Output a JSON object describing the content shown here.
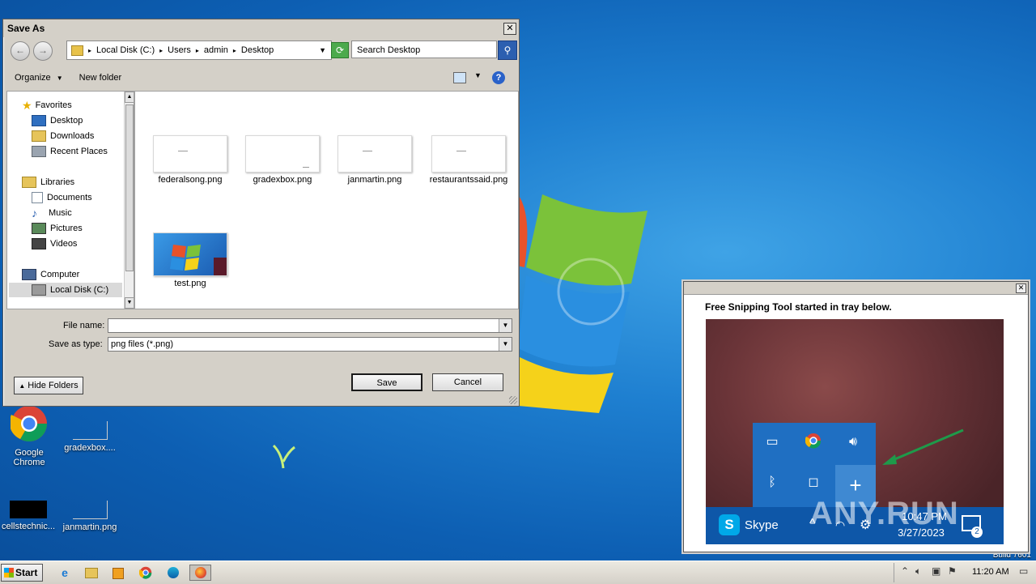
{
  "desktop": {
    "icons": [
      {
        "name": "google-chrome",
        "label": "Google\nChrome"
      },
      {
        "name": "gradexbox",
        "label": "gradexbox...."
      },
      {
        "name": "cellstechnic",
        "label": "cellstechnic..."
      },
      {
        "name": "janmartin",
        "label": "janmartin.png"
      }
    ],
    "build_text": "Build 7601"
  },
  "dialog": {
    "title": "Save As",
    "close_label": "✕",
    "breadcrumb": [
      "Local Disk (C:)",
      "Users",
      "admin",
      "Desktop"
    ],
    "search_placeholder": "Search Desktop",
    "toolbar": {
      "organize": "Organize",
      "new_folder": "New folder"
    },
    "nav": {
      "favorites": "Favorites",
      "desktop": "Desktop",
      "downloads": "Downloads",
      "recent_places": "Recent Places",
      "libraries": "Libraries",
      "documents": "Documents",
      "music": "Music",
      "pictures": "Pictures",
      "videos": "Videos",
      "computer": "Computer",
      "local_disk": "Local Disk (C:)"
    },
    "files": [
      {
        "name": "federalsong.png"
      },
      {
        "name": "gradexbox.png"
      },
      {
        "name": "janmartin.png"
      },
      {
        "name": "restaurantssaid.png"
      },
      {
        "name": "test.png"
      }
    ],
    "file_name_label": "File name:",
    "file_name_value": "",
    "save_type_label": "Save as type:",
    "save_type_value": "png files (*.png)",
    "hide_folders": "Hide Folders",
    "save": "Save",
    "cancel": "Cancel"
  },
  "snip": {
    "message": "Free Snipping Tool started in tray below.",
    "skype_label": "Skype",
    "time": "10:47 PM",
    "date": "3/27/2023",
    "notif_count": "2"
  },
  "watermark": "ANY.RUN",
  "taskbar": {
    "start_label": "Start",
    "clock": "11:20 AM"
  }
}
